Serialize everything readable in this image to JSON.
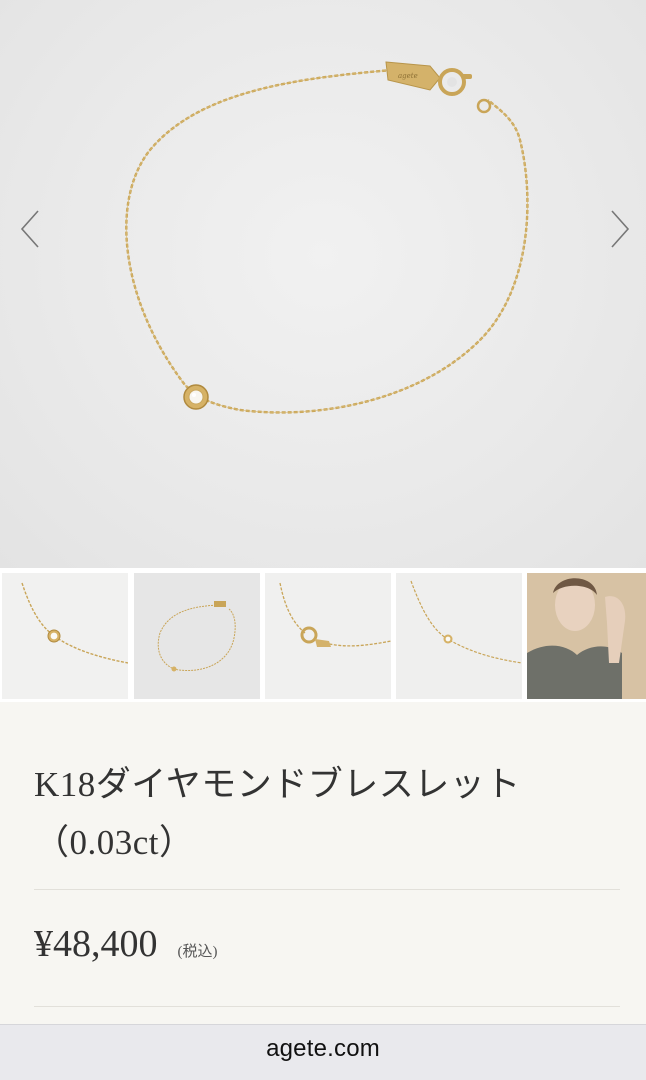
{
  "gallery": {
    "prev_icon": "chevron-left-icon",
    "next_icon": "chevron-right-icon",
    "thumbnails": [
      {
        "name": "thumb-closeup-stone"
      },
      {
        "name": "thumb-full-bracelet"
      },
      {
        "name": "thumb-clasp"
      },
      {
        "name": "thumb-stone-side"
      },
      {
        "name": "thumb-model-wearing"
      }
    ]
  },
  "product": {
    "title_line1": "K18ダイヤモンドブレスレット",
    "title_line2": "（0.03ct）",
    "price": "¥48,400",
    "tax_note": "(税込)"
  },
  "browser": {
    "url": "agete.com"
  },
  "colors": {
    "gold": "#c9a558",
    "background": "#f7f6f2",
    "text": "#333333"
  }
}
